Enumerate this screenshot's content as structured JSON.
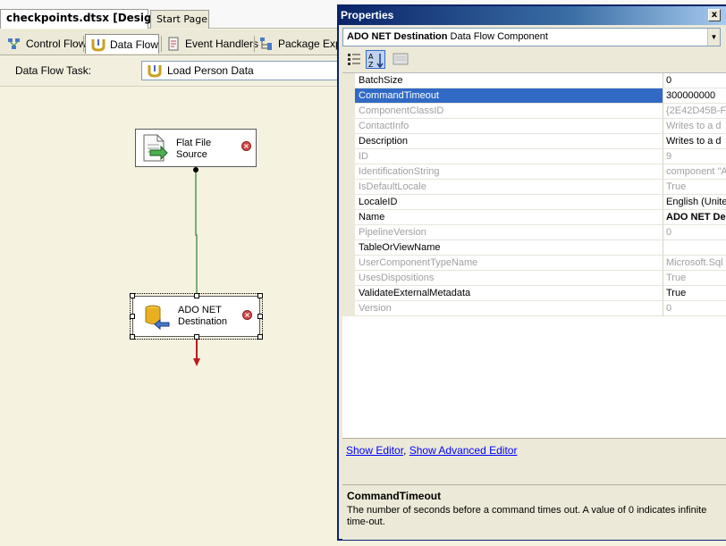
{
  "doc_tabs": {
    "active": "checkpoints.dtsx [Design]*",
    "other": "Start Page"
  },
  "designer_tabs": [
    {
      "label": "Control Flow",
      "icon": "control-flow-icon"
    },
    {
      "label": "Data Flow",
      "icon": "data-flow-icon"
    },
    {
      "label": "Event Handlers",
      "icon": "event-handlers-icon"
    },
    {
      "label": "Package Explo",
      "icon": "package-explorer-icon"
    }
  ],
  "task_bar": {
    "label": "Data Flow Task:",
    "value": "Load  Person Data"
  },
  "components": {
    "source": {
      "line1": "Flat File",
      "line2": "Source"
    },
    "destination": {
      "line1": "ADO NET",
      "line2": "Destination"
    }
  },
  "properties": {
    "title": "Properties",
    "close": "x",
    "object_name": "ADO NET Destination",
    "object_type": "Data Flow Component",
    "rows": [
      {
        "name": "BatchSize",
        "value": "0"
      },
      {
        "name": "CommandTimeout",
        "value": "300000000"
      },
      {
        "name": "ComponentClassID",
        "value": "{2E42D45B-F"
      },
      {
        "name": "ContactInfo",
        "value": "Writes to a d"
      },
      {
        "name": "Description",
        "value": "Writes to a d"
      },
      {
        "name": "ID",
        "value": "9"
      },
      {
        "name": "IdentificationString",
        "value": "component \"A"
      },
      {
        "name": "IsDefaultLocale",
        "value": "True"
      },
      {
        "name": "LocaleID",
        "value": "English (Unite"
      },
      {
        "name": "Name",
        "value": "ADO NET De"
      },
      {
        "name": "PipelineVersion",
        "value": "0"
      },
      {
        "name": "TableOrViewName",
        "value": ""
      },
      {
        "name": "UserComponentTypeName",
        "value": "Microsoft.Sql"
      },
      {
        "name": "UsesDispositions",
        "value": "True"
      },
      {
        "name": "ValidateExternalMetadata",
        "value": "True"
      },
      {
        "name": "Version",
        "value": "0"
      }
    ],
    "links": {
      "show_editor": "Show Editor",
      "separator": ", ",
      "show_advanced_editor": "Show Advanced Editor"
    },
    "description": {
      "title": "CommandTimeout",
      "text": "The number of seconds before a command times out. A value of 0 indicates infinite time-out."
    }
  }
}
